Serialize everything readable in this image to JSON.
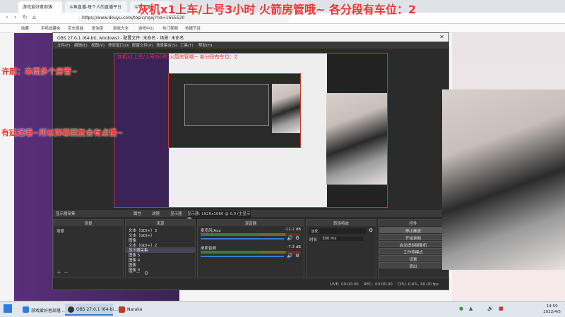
{
  "overlay": {
    "top_text": "灰机x1上车/上号3小时   火箭房管哦~   各分段有车位：2",
    "line1": "许愿：本周多个房管~",
    "line2": "有延迟哦~所以弹幕回复会有点慢~"
  },
  "browser": {
    "tabs": [
      "游戏爱好者部落",
      "斗鱼直播-每个人的直播平台",
      "斗鱼直播…"
    ],
    "url": "https://www.douyu.com/topic/ngxj?rid=1655520",
    "bookmarks": [
      "收藏",
      "手机收藏夹",
      "京东商城",
      "爱淘宝",
      "游戏大全",
      "游戏中心",
      "热门视频",
      "热播节目"
    ]
  },
  "obs": {
    "title": "OBS 27.0.1 (64-bit, windows) - 配置文件: 未命名 - 场景: 未命名",
    "menu": [
      "文件(F)",
      "编辑(E)",
      "视图(V)",
      "停靠窗口(D)",
      "配置文件(P)",
      "场景集合(S)",
      "工具(T)",
      "帮助(H)"
    ],
    "preview_overlay": "灰机x1上车/上号3小时   火箭房管哦~   各分段有车位：2",
    "source_bar": {
      "selected": "显示器采集",
      "props": "属性",
      "filters": "滤镜",
      "display_label": "显示器",
      "display_value": "显示器: 1920x1080 @ 0,0 (主显示器)"
    },
    "docks": {
      "scenes": {
        "title": "场景",
        "items": [
          "场景"
        ]
      },
      "sources": {
        "title": "来源",
        "items": [
          "文本（GDI+）3",
          "文本（GDI+）",
          "图像",
          "文本（GDI+）2",
          "显示器采集",
          "图像 5",
          "图像 4",
          "图像",
          "图像 3"
        ]
      },
      "mixer": {
        "title": "混音器",
        "channels": [
          {
            "name": "麦克风/Aux",
            "db": "-12.2 dB"
          },
          {
            "name": "桌面音频",
            "db": "-7.3 dB"
          }
        ]
      },
      "transitions": {
        "title": "转场特效",
        "type": "淡化",
        "duration_label": "时长",
        "duration": "300 ms"
      },
      "controls": {
        "title": "控件",
        "buttons": [
          "停止推流",
          "开始录制",
          "启动虚拟摄像机",
          "工作室模式",
          "设置",
          "退出"
        ]
      }
    },
    "status": {
      "live_label": "LIVE:",
      "live_time": "00:00:00",
      "rec_label": "REC:",
      "rec_time": "00:00:00",
      "cpu": "CPU: 0.6%, 60.00 fps"
    }
  },
  "taskbar": {
    "items": [
      {
        "label": "游戏爱好者部落 …",
        "color": "#2a7de1"
      },
      {
        "label": "OBS 27.0.1 (64-bi…",
        "color": "#333333"
      },
      {
        "label": "Naraka",
        "color": "#c0392b"
      }
    ],
    "clock_time": "14:59",
    "clock_date": "2022/4/5"
  }
}
